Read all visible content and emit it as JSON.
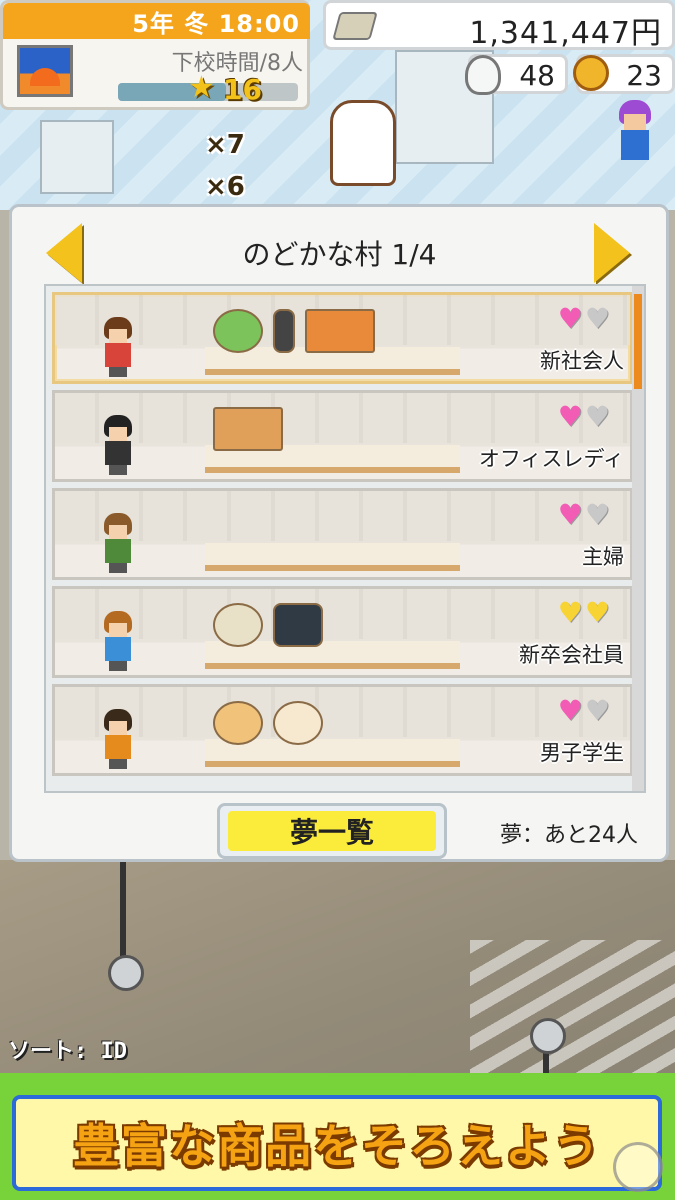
{
  "hud": {
    "date": "5年  冬  18:00",
    "status": "下校時間/8人",
    "rank": "16",
    "money": "1,341,447円",
    "ideas": "48",
    "medals": "23"
  },
  "scene": {
    "stack_1": "×7",
    "stack_2": "×6",
    "sort_label": "ソート: ID"
  },
  "dialog": {
    "title": "のどかな村  1/4",
    "rows": [
      {
        "label": "新社会人",
        "hearts": [
          "pink",
          "grey"
        ],
        "goods": [
          "salad-bowl",
          "phone",
          "bento-box"
        ],
        "hair": "#6b3b1a",
        "shirt": "#d9443a"
      },
      {
        "label": "オフィスレディ",
        "hearts": [
          "pink",
          "grey"
        ],
        "goods": [
          "fried-food-bento"
        ],
        "hair": "#222222",
        "shirt": "#333333"
      },
      {
        "label": "主婦",
        "hearts": [
          "pink",
          "grey"
        ],
        "goods": [],
        "hair": "#8a5a2a",
        "shirt": "#4f8a3a"
      },
      {
        "label": "新卒会社員",
        "hearts": [
          "yellow",
          "yellow"
        ],
        "goods": [
          "noodle-bowl",
          "onigiri"
        ],
        "hair": "#b56a22",
        "shirt": "#3a8fd6"
      },
      {
        "label": "男子学生",
        "hearts": [
          "pink",
          "grey"
        ],
        "goods": [
          "pudding",
          "ice-cream-cone"
        ],
        "hair": "#3a2a1a",
        "shirt": "#e58a1c"
      }
    ],
    "dream_button": "夢一覧",
    "dream_count": "夢：あと24人"
  },
  "banner": {
    "text": "豊富な商品をそろえよう"
  },
  "colors": {
    "accent_orange": "#f4a51c",
    "heart_pink": "#f25cb5",
    "heart_grey": "#c8c8c8",
    "heart_yellow": "#f7d433",
    "banner_green": "#78d23a",
    "banner_border": "#2b6ad8"
  }
}
